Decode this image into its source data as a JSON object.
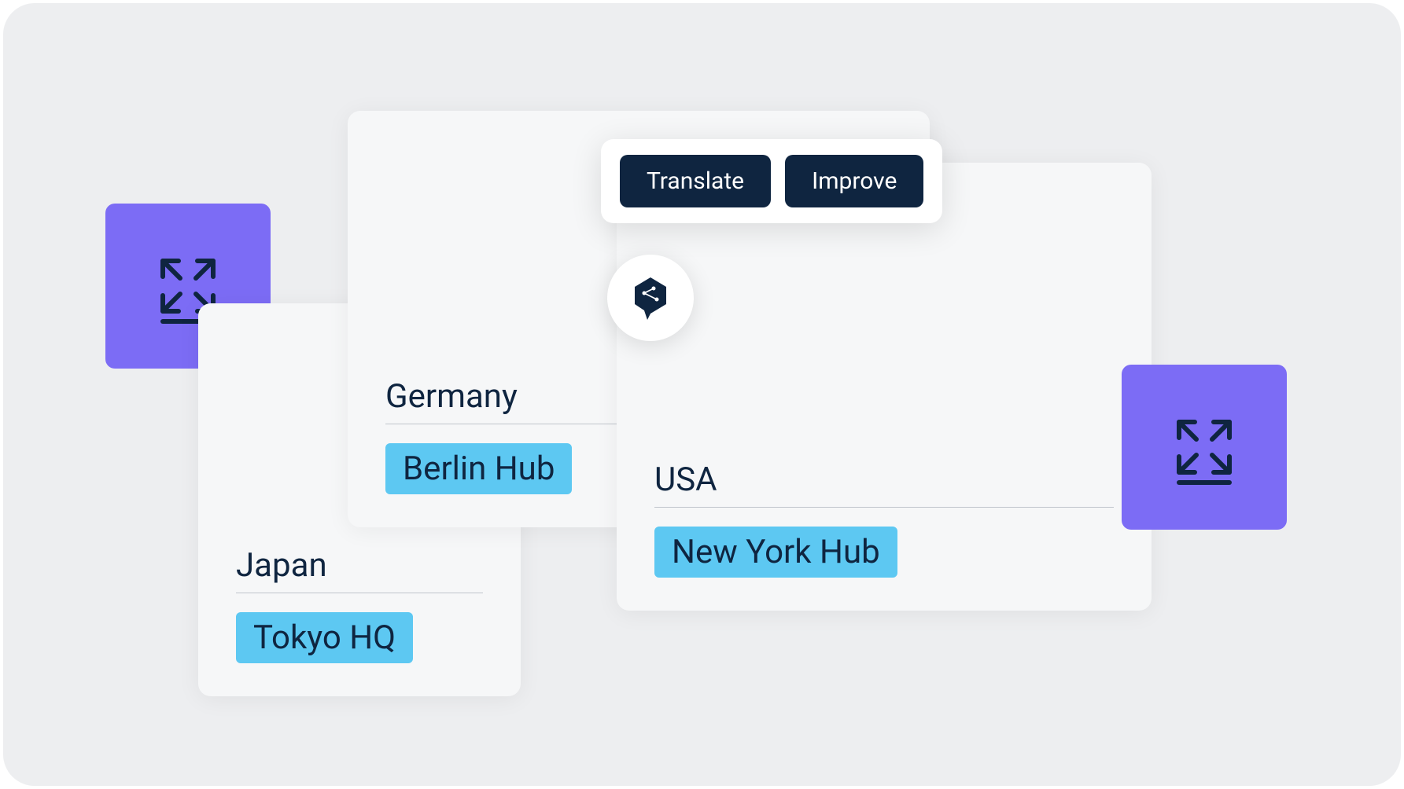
{
  "toolbar": {
    "translate_label": "Translate",
    "improve_label": "Improve"
  },
  "cards": {
    "japan": {
      "country": "Japan",
      "hub": "Tokyo HQ"
    },
    "germany": {
      "country": "Germany",
      "hub": "Berlin Hub"
    },
    "usa": {
      "country": "USA",
      "hub": "New York Hub"
    }
  },
  "colors": {
    "accent_purple": "#7c6cf5",
    "accent_blue": "#5dc8f2",
    "dark_navy": "#0f2540",
    "panel_bg": "#f6f7f8"
  }
}
